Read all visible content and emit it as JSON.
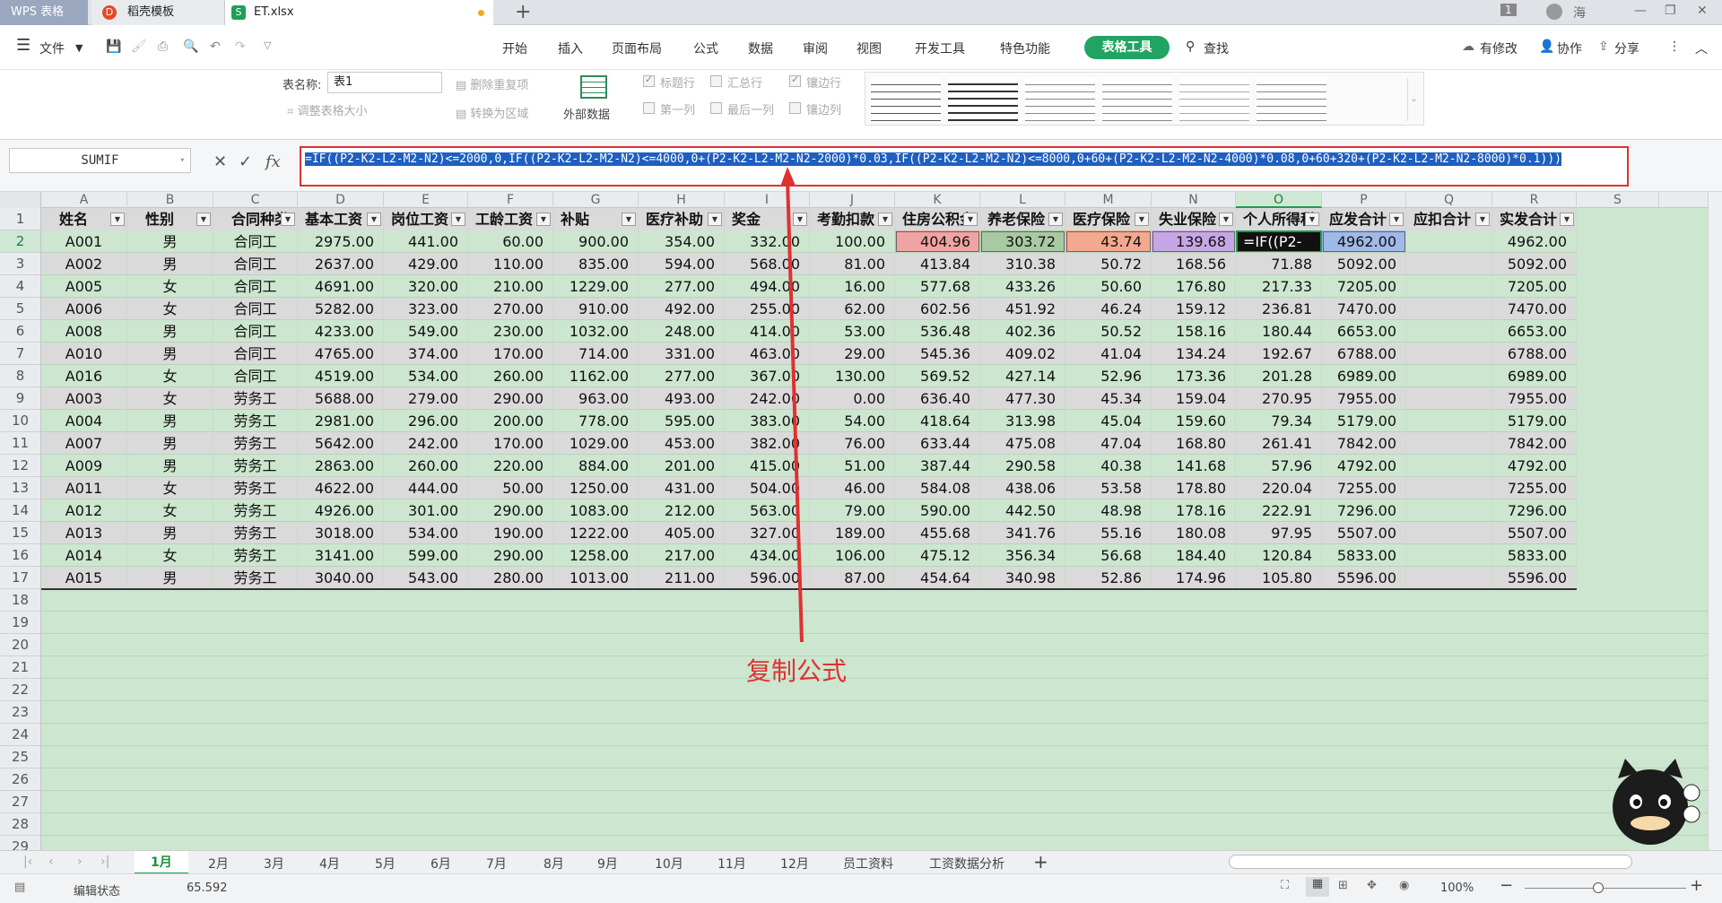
{
  "tabs": {
    "wps": "WPS 表格",
    "template": "稻壳模板",
    "doc": "ET.xlsx",
    "count": "1",
    "user": "海"
  },
  "menu": {
    "file": "文件",
    "items": [
      "开始",
      "插入",
      "页面布局",
      "公式",
      "数据",
      "审阅",
      "视图",
      "开发工具",
      "特色功能"
    ],
    "active": "表格工具",
    "search": "查找",
    "right": [
      "有修改",
      "协作",
      "分享"
    ]
  },
  "ribbon": {
    "table_name_label": "表名称:",
    "table_name": "表1",
    "resize": "调整表格大小",
    "remove_dup": "删除重复项",
    "convert": "转换为区域",
    "external": "外部数据",
    "checks": [
      "标题行",
      "汇总行",
      "镶边行",
      "第一列",
      "最后一列",
      "镶边列"
    ]
  },
  "formula_bar": {
    "name_box": "SUMIF",
    "fx": "fx",
    "formula": "=IF((P2-K2-L2-M2-N2)<=2000,0,IF((P2-K2-L2-M2-N2)<=4000,0+(P2-K2-L2-M2-N2-2000)*0.03,IF((P2-K2-L2-M2-N2)<=8000,0+60+(P2-K2-L2-M2-N2-4000)*0.08,0+60+320+(P2-K2-L2-M2-N2-8000)*0.1)))"
  },
  "columns": [
    "A",
    "B",
    "C",
    "D",
    "E",
    "F",
    "G",
    "H",
    "I",
    "J",
    "K",
    "L",
    "M",
    "N",
    "O",
    "P",
    "Q",
    "R",
    "S"
  ],
  "headers": [
    "姓名",
    "性别",
    "合同种类",
    "基本工资",
    "岗位工资",
    "工龄工资",
    "补贴",
    "医疗补助",
    "奖金",
    "考勤扣款",
    "住房公积金",
    "养老保险",
    "医疗保险",
    "失业保险",
    "个人所得税",
    "应发合计",
    "应扣合计",
    "实发合计"
  ],
  "rows": [
    [
      "A001",
      "男",
      "合同工",
      "2975.00",
      "441.00",
      "60.00",
      "900.00",
      "354.00",
      "332.00",
      "100.00",
      "404.96",
      "303.72",
      "43.74",
      "139.68",
      "=IF((P2-",
      "4962.00",
      "",
      "4962.00"
    ],
    [
      "A002",
      "男",
      "合同工",
      "2637.00",
      "429.00",
      "110.00",
      "835.00",
      "594.00",
      "568.00",
      "81.00",
      "413.84",
      "310.38",
      "50.72",
      "168.56",
      "71.88",
      "5092.00",
      "",
      "5092.00"
    ],
    [
      "A005",
      "女",
      "合同工",
      "4691.00",
      "320.00",
      "210.00",
      "1229.00",
      "277.00",
      "494.00",
      "16.00",
      "577.68",
      "433.26",
      "50.60",
      "176.80",
      "217.33",
      "7205.00",
      "",
      "7205.00"
    ],
    [
      "A006",
      "女",
      "合同工",
      "5282.00",
      "323.00",
      "270.00",
      "910.00",
      "492.00",
      "255.00",
      "62.00",
      "602.56",
      "451.92",
      "46.24",
      "159.12",
      "236.81",
      "7470.00",
      "",
      "7470.00"
    ],
    [
      "A008",
      "男",
      "合同工",
      "4233.00",
      "549.00",
      "230.00",
      "1032.00",
      "248.00",
      "414.00",
      "53.00",
      "536.48",
      "402.36",
      "50.52",
      "158.16",
      "180.44",
      "6653.00",
      "",
      "6653.00"
    ],
    [
      "A010",
      "男",
      "合同工",
      "4765.00",
      "374.00",
      "170.00",
      "714.00",
      "331.00",
      "463.00",
      "29.00",
      "545.36",
      "409.02",
      "41.04",
      "134.24",
      "192.67",
      "6788.00",
      "",
      "6788.00"
    ],
    [
      "A016",
      "女",
      "合同工",
      "4519.00",
      "534.00",
      "260.00",
      "1162.00",
      "277.00",
      "367.00",
      "130.00",
      "569.52",
      "427.14",
      "52.96",
      "173.36",
      "201.28",
      "6989.00",
      "",
      "6989.00"
    ],
    [
      "A003",
      "女",
      "劳务工",
      "5688.00",
      "279.00",
      "290.00",
      "963.00",
      "493.00",
      "242.00",
      "0.00",
      "636.40",
      "477.30",
      "45.34",
      "159.04",
      "270.95",
      "7955.00",
      "",
      "7955.00"
    ],
    [
      "A004",
      "男",
      "劳务工",
      "2981.00",
      "296.00",
      "200.00",
      "778.00",
      "595.00",
      "383.00",
      "54.00",
      "418.64",
      "313.98",
      "45.04",
      "159.60",
      "79.34",
      "5179.00",
      "",
      "5179.00"
    ],
    [
      "A007",
      "男",
      "劳务工",
      "5642.00",
      "242.00",
      "170.00",
      "1029.00",
      "453.00",
      "382.00",
      "76.00",
      "633.44",
      "475.08",
      "47.04",
      "168.80",
      "261.41",
      "7842.00",
      "",
      "7842.00"
    ],
    [
      "A009",
      "男",
      "劳务工",
      "2863.00",
      "260.00",
      "220.00",
      "884.00",
      "201.00",
      "415.00",
      "51.00",
      "387.44",
      "290.58",
      "40.38",
      "141.68",
      "57.96",
      "4792.00",
      "",
      "4792.00"
    ],
    [
      "A011",
      "女",
      "劳务工",
      "4622.00",
      "444.00",
      "50.00",
      "1250.00",
      "431.00",
      "504.00",
      "46.00",
      "584.08",
      "438.06",
      "53.58",
      "178.80",
      "220.04",
      "7255.00",
      "",
      "7255.00"
    ],
    [
      "A012",
      "女",
      "劳务工",
      "4926.00",
      "301.00",
      "290.00",
      "1083.00",
      "212.00",
      "563.00",
      "79.00",
      "590.00",
      "442.50",
      "48.98",
      "178.16",
      "222.91",
      "7296.00",
      "",
      "7296.00"
    ],
    [
      "A013",
      "男",
      "劳务工",
      "3018.00",
      "534.00",
      "190.00",
      "1222.00",
      "405.00",
      "327.00",
      "189.00",
      "455.68",
      "341.76",
      "55.16",
      "180.08",
      "97.95",
      "5507.00",
      "",
      "5507.00"
    ],
    [
      "A014",
      "女",
      "劳务工",
      "3141.00",
      "599.00",
      "290.00",
      "1258.00",
      "217.00",
      "434.00",
      "106.00",
      "475.12",
      "356.34",
      "56.68",
      "184.40",
      "120.84",
      "5833.00",
      "",
      "5833.00"
    ],
    [
      "A015",
      "男",
      "劳务工",
      "3040.00",
      "543.00",
      "280.00",
      "1013.00",
      "211.00",
      "596.00",
      "87.00",
      "454.64",
      "340.98",
      "52.86",
      "174.96",
      "105.80",
      "5596.00",
      "",
      "5596.00"
    ]
  ],
  "row_numbers": [
    "1",
    "2",
    "3",
    "4",
    "5",
    "6",
    "7",
    "8",
    "9",
    "10",
    "11",
    "12",
    "13",
    "14",
    "15",
    "16",
    "17",
    "18",
    "19",
    "20",
    "21",
    "22",
    "23",
    "24",
    "25",
    "26",
    "27",
    "28",
    "29"
  ],
  "annotation": "复制公式",
  "sheets": [
    "1月",
    "2月",
    "3月",
    "4月",
    "5月",
    "6月",
    "7月",
    "8月",
    "9月",
    "10月",
    "11月",
    "12月",
    "员工资料",
    "工资数据分析"
  ],
  "status": {
    "mode": "编辑状态",
    "value": "65.592",
    "zoom": "100%"
  },
  "colors": {
    "accent": "#1fa462",
    "annot": "#e03131",
    "cell_bg": "#cce6cf",
    "ref_k": "#f0a3a3",
    "ref_l": "#a9c9a2",
    "ref_m": "#f3a88f",
    "ref_n": "#c7a6e6",
    "ref_p": "#9fb9e8"
  }
}
